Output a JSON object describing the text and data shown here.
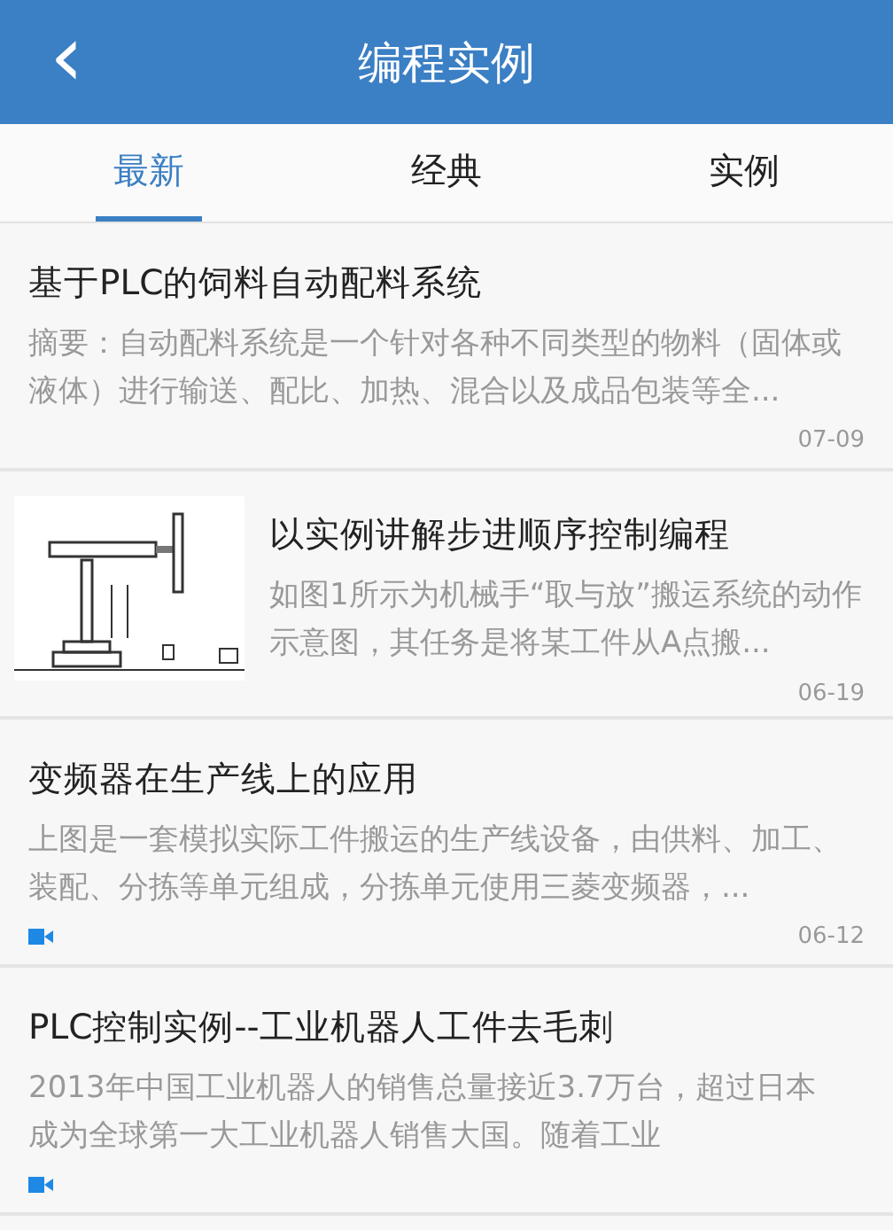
{
  "header": {
    "back_icon": "‹",
    "title": "编程实例"
  },
  "tabs": [
    {
      "label": "最新",
      "selected": true
    },
    {
      "label": "经典",
      "selected": false
    },
    {
      "label": "实例",
      "selected": false
    }
  ],
  "articles": [
    {
      "title": "基于PLC的饲料自动配料系统",
      "summary": "摘要：自动配料系统是一个针对各种不同类型的物料（固体或液体）进行输送、配比、加热、混合以及成品包装等全...",
      "date": "07-09",
      "has_picture": false,
      "video": false
    },
    {
      "title": "以实例讲解步进顺序控制编程",
      "summary": "如图1所示为机械手“取与放”搬运系统的动作示意图，其任务是将某工件从A点搬...",
      "date": "06-19",
      "has_picture": true,
      "video": false
    },
    {
      "title": "变频器在生产线上的应用",
      "summary": "上图是一套模拟实际工件搬运的生产线设备，由供料、加工、装配、分拣等单元组成，分拣单元使用三菱变频器，...",
      "date": "06-12",
      "has_picture": false,
      "video": true
    },
    {
      "title": "PLC控制实例--工业机器人工件去毛刺",
      "summary": "2013年中国工业机器人的销售总量接近3.7万台，超过日本成为全球第一大工业机器人销售大国。随着工业",
      "has_picture": false,
      "video": true
    }
  ]
}
